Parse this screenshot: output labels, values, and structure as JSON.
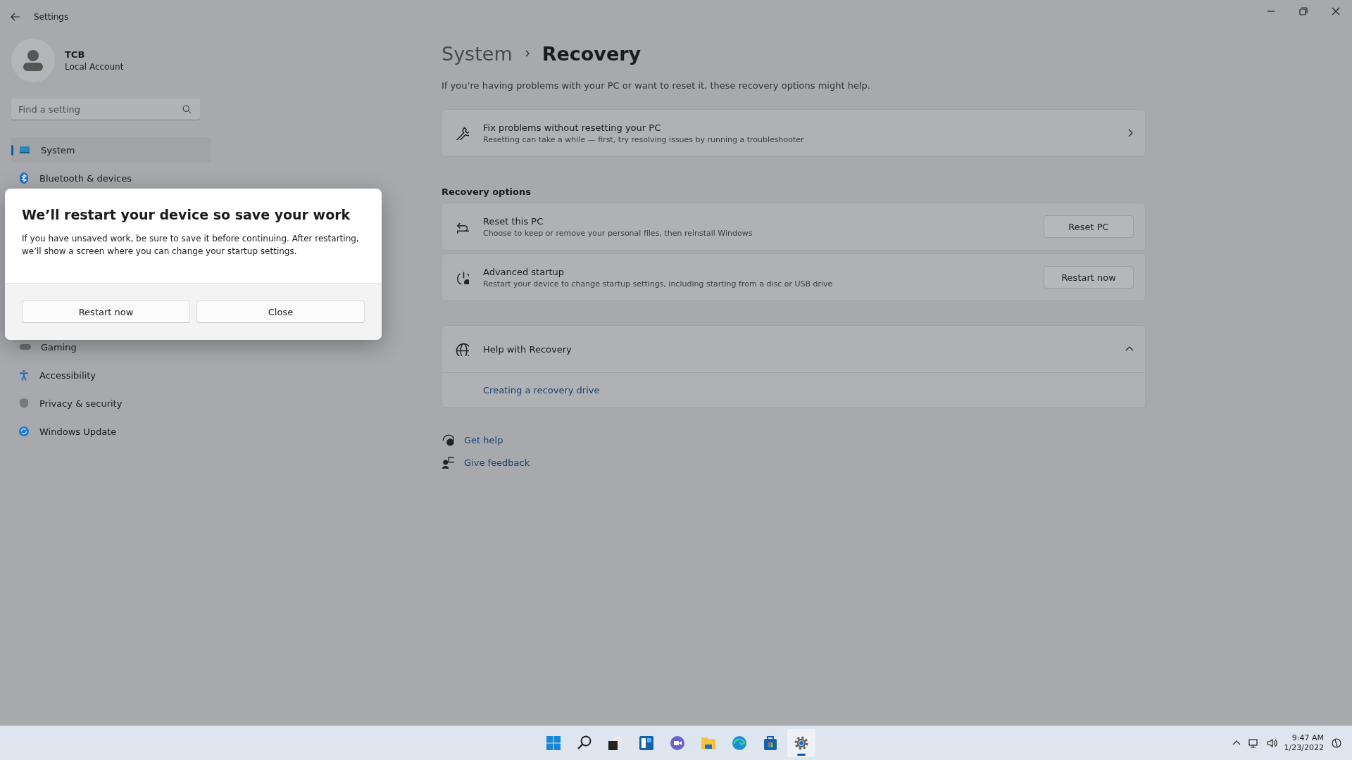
{
  "window": {
    "title": "Settings"
  },
  "account": {
    "name": "TCB",
    "type": "Local Account"
  },
  "search": {
    "placeholder": "Find a setting"
  },
  "sidebar": {
    "items": [
      {
        "label": "System",
        "kind": "system",
        "selected": true
      },
      {
        "label": "Bluetooth & devices",
        "kind": "bluetooth",
        "selected": false
      }
    ],
    "items_below_dialog": [
      {
        "label": "Gaming",
        "kind": "gaming",
        "selected": false
      },
      {
        "label": "Accessibility",
        "kind": "accessibility",
        "selected": false
      },
      {
        "label": "Privacy & security",
        "kind": "privacy",
        "selected": false
      },
      {
        "label": "Windows Update",
        "kind": "update",
        "selected": false
      }
    ]
  },
  "breadcrumb": {
    "parent": "System",
    "current": "Recovery"
  },
  "description": "If you’re having problems with your PC or want to reset it, these recovery options might help.",
  "fix_card": {
    "title": "Fix problems without resetting your PC",
    "subtitle": "Resetting can take a while — first, try resolving issues by running a troubleshooter"
  },
  "recovery_options": {
    "heading": "Recovery options",
    "rows": [
      {
        "kind": "reset",
        "title": "Reset this PC",
        "subtitle": "Choose to keep or remove your personal files, then reinstall Windows",
        "button": "Reset PC"
      },
      {
        "kind": "startup",
        "title": "Advanced startup",
        "subtitle": "Restart your device to change startup settings, including starting from a disc or USB drive",
        "button": "Restart now"
      }
    ]
  },
  "help": {
    "title": "Help with Recovery",
    "expanded": true,
    "links": [
      "Creating a recovery drive"
    ]
  },
  "footer_links": [
    {
      "kind": "help",
      "label": "Get help"
    },
    {
      "kind": "feedback",
      "label": "Give feedback"
    }
  ],
  "dialog": {
    "title": "We’ll restart your device so save your work",
    "body": "If you have unsaved work, be sure to save it before continuing. After restarting, we’ll show a screen where you can change your startup settings.",
    "buttons": [
      "Restart now",
      "Close"
    ]
  },
  "taskbar": {
    "apps": [
      {
        "kind": "start",
        "selected": false
      },
      {
        "kind": "search",
        "selected": false
      },
      {
        "kind": "taskview",
        "selected": false
      },
      {
        "kind": "widgets",
        "selected": false
      },
      {
        "kind": "chat",
        "selected": false
      },
      {
        "kind": "explorer",
        "selected": false
      },
      {
        "kind": "edge",
        "selected": false
      },
      {
        "kind": "store",
        "selected": false
      },
      {
        "kind": "settings",
        "selected": true
      }
    ],
    "time": "9:47 AM",
    "date": "1/23/2022"
  }
}
